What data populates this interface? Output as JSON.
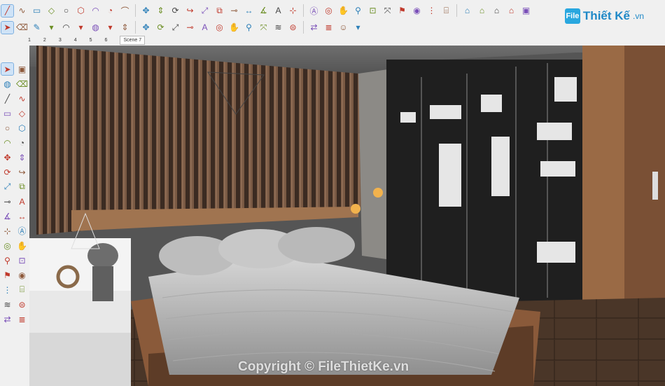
{
  "app": {
    "logo_mark": "File",
    "logo_name": "Thiết Kế",
    "logo_tld": ".vn"
  },
  "scenes": {
    "numbers": [
      "1",
      "2",
      "3",
      "4",
      "5",
      "6"
    ],
    "active_tab": "Scene 7"
  },
  "toolbar_top": {
    "icons": [
      "line-icon",
      "freehand-icon",
      "rectangle-icon",
      "rotated-rect-icon",
      "circle-icon",
      "polygon-icon",
      "arc-icon",
      "pie-icon",
      "arc3-icon",
      "move-icon",
      "pushpull-icon",
      "rotate-icon",
      "followme-icon",
      "scale-icon",
      "offset-icon",
      "tape-icon",
      "dimension-icon",
      "protractor-icon",
      "text-icon",
      "axes-icon",
      "3dtext-icon",
      "orbit-icon",
      "pan-icon",
      "zoom-icon",
      "zoomwindow-icon",
      "zoomextents-icon",
      "position-camera-icon",
      "lookaround-icon",
      "walk-icon",
      "section-icon",
      "warehouse-icon",
      "extension-icon",
      "house-icon",
      "house2-icon",
      "component-icon"
    ]
  },
  "toolbar_second": {
    "icons": [
      "select-icon",
      "eraser-icon",
      "pencil-icon",
      "dropdown-icon",
      "arc-tool-icon",
      "dropdown-icon",
      "paint-bucket-icon",
      "dropdown-icon",
      "pushpull-icon",
      "move-icon",
      "rotate-icon",
      "scale-icon",
      "tape-icon",
      "text-icon",
      "orbit-icon",
      "pan-icon",
      "zoom-icon",
      "zoom-extents-icon",
      "sandbox-icon",
      "stamp-icon",
      "flip-icon",
      "layers-icon",
      "user-icon",
      "dropdown-icon"
    ]
  },
  "left_toolbar": {
    "icons": [
      "select-icon",
      "component-icon",
      "paint-icon",
      "eraser-icon",
      "line-icon",
      "freehand-icon",
      "rectangle-icon",
      "rotated-rect-icon",
      "circle-icon",
      "polygon-icon",
      "arc-icon",
      "pie-icon",
      "move-icon",
      "pushpull-icon",
      "rotate-icon",
      "followme-icon",
      "scale-icon",
      "offset-icon",
      "tape-icon",
      "text-icon",
      "protractor-icon",
      "dimension-icon",
      "axes-icon",
      "3dtext-icon",
      "orbit-icon",
      "pan-icon",
      "zoom-icon",
      "zoomwindow-icon",
      "position-camera-icon",
      "lookaround-icon",
      "walk-icon",
      "section-icon",
      "sandbox-icon",
      "stamp-icon",
      "flip-icon",
      "layers-icon"
    ]
  },
  "watermark": "Copyright © FileThietKe.vn",
  "colors": {
    "toolbar_bg": "#f0f0f0",
    "accent": "#29a7df",
    "wood": "#8a5a3a",
    "bedding": "#c9c9c9"
  }
}
